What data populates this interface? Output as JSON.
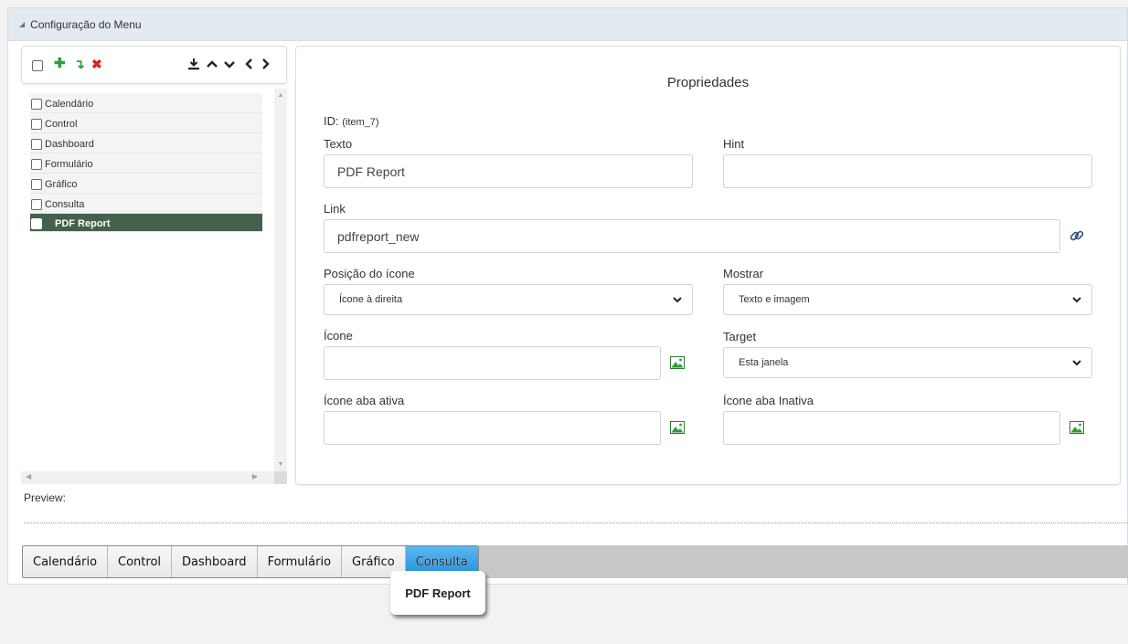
{
  "panel": {
    "title": "Configuração do Menu"
  },
  "tree": {
    "items": [
      {
        "label": "Calendário",
        "selected": false
      },
      {
        "label": "Control",
        "selected": false
      },
      {
        "label": "Dashboard",
        "selected": false
      },
      {
        "label": "Formulário",
        "selected": false
      },
      {
        "label": "Gráfico",
        "selected": false
      },
      {
        "label": "Consulta",
        "selected": false
      },
      {
        "label": "PDF Report",
        "selected": true
      }
    ]
  },
  "props": {
    "title": "Propriedades",
    "id_label": "ID:",
    "id_value": "(item_7)",
    "texto_label": "Texto",
    "texto_value": "PDF Report",
    "hint_label": "Hint",
    "hint_value": "",
    "link_label": "Link",
    "link_value": "pdfreport_new",
    "posicao_label": "Posição do ícone",
    "posicao_value": "Ícone à direita",
    "mostrar_label": "Mostrar",
    "mostrar_value": "Texto e imagem",
    "icone_label": "Ícone",
    "icone_value": "",
    "target_label": "Target",
    "target_value": "Esta janela",
    "icone_ativa_label": "Ícone aba ativa",
    "icone_ativa_value": "",
    "icone_inativa_label": "Ícone aba Inativa",
    "icone_inativa_value": ""
  },
  "preview": {
    "label": "Preview:",
    "tabs": [
      "Calendário",
      "Control",
      "Dashboard",
      "Formulário",
      "Gráfico",
      "Consulta"
    ],
    "active_tab": "Consulta",
    "dropdown_item": "PDF Report"
  },
  "colors": {
    "header_bg": "#e4eaf2",
    "selected_item_bg": "#44614b",
    "active_tab": "#1d8fdc",
    "add_green": "#2e9e3e",
    "delete_red": "#d9241c"
  }
}
